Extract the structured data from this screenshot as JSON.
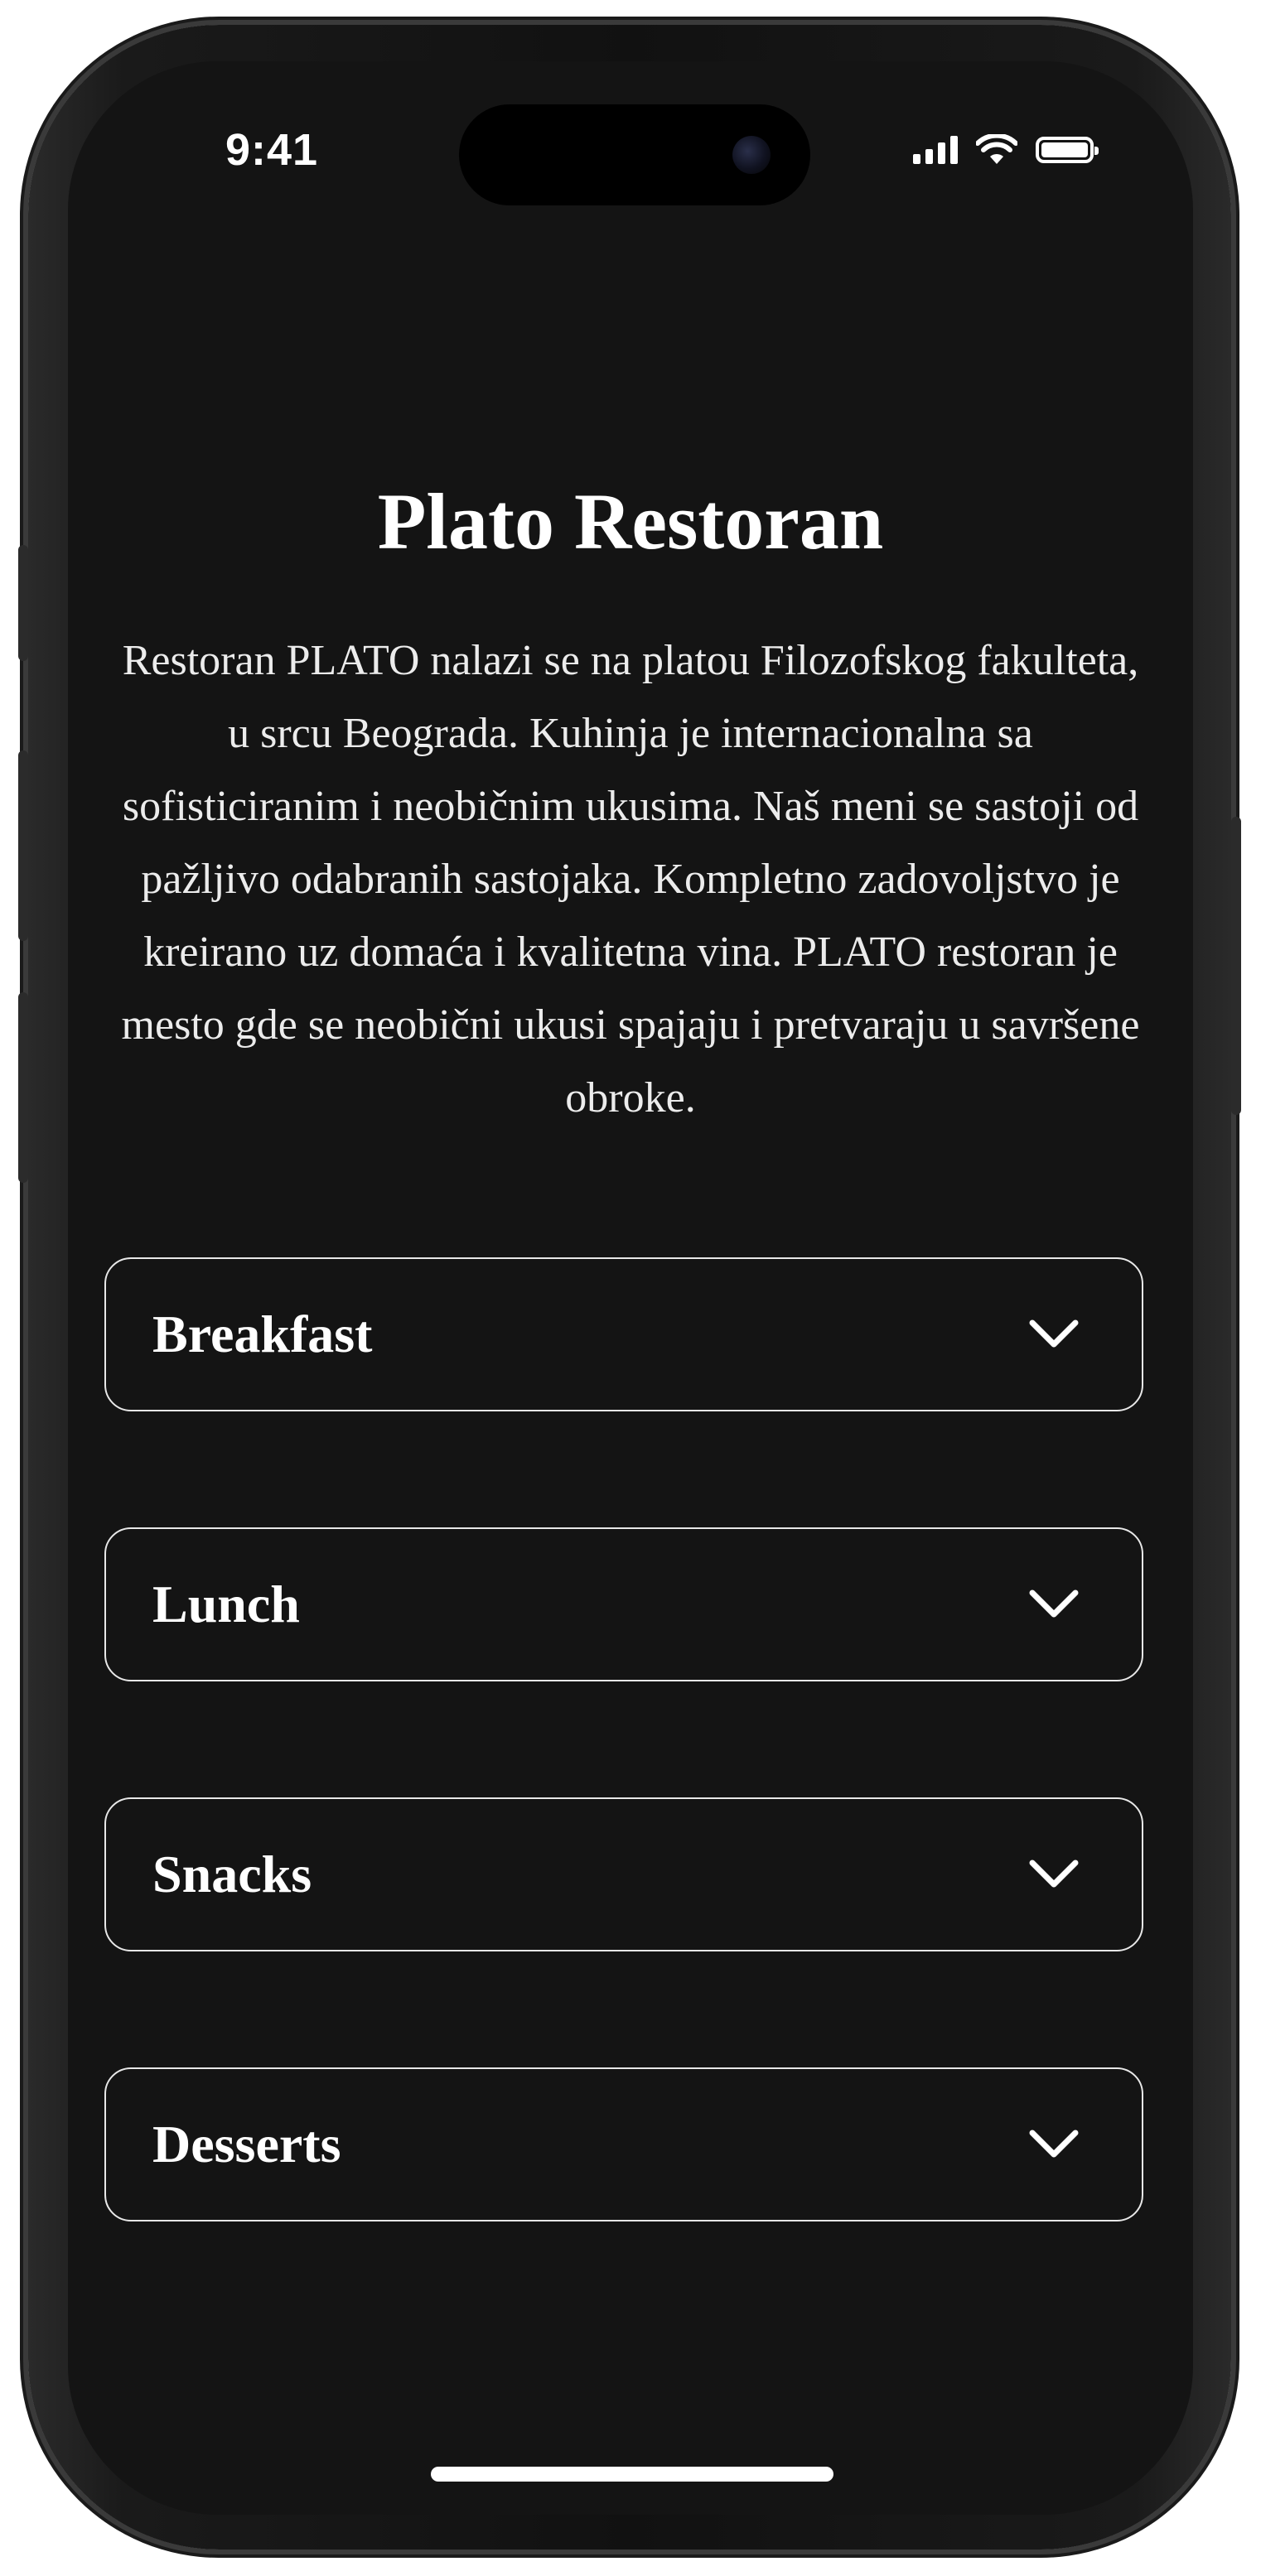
{
  "status_bar": {
    "time": "9:41",
    "icons": [
      "cellular-signal-icon",
      "wifi-icon",
      "battery-icon"
    ]
  },
  "page": {
    "title": "Plato Restoran",
    "description": "Restoran PLATO nalazi se na platou Filozofskog fakulteta, u srcu Beograda. Kuhinja je internacionalna sa sofisticiranim i neobičnim ukusima. Naš meni se sastoji od pažljivo odabranih sastojaka. Kompletno zadovoljstvo je kreirano uz domaća i kvalitetna vina. PLATO restoran je mesto gde se neobični ukusi spajaju i pretvaraju u savršene obroke."
  },
  "menu": {
    "sections": [
      {
        "label": "Breakfast",
        "expanded": false
      },
      {
        "label": "Lunch",
        "expanded": false
      },
      {
        "label": "Snacks",
        "expanded": false
      },
      {
        "label": "Desserts",
        "expanded": false
      }
    ]
  },
  "colors": {
    "background": "#141414",
    "text": "#ffffff",
    "border": "#e8e8e8"
  }
}
